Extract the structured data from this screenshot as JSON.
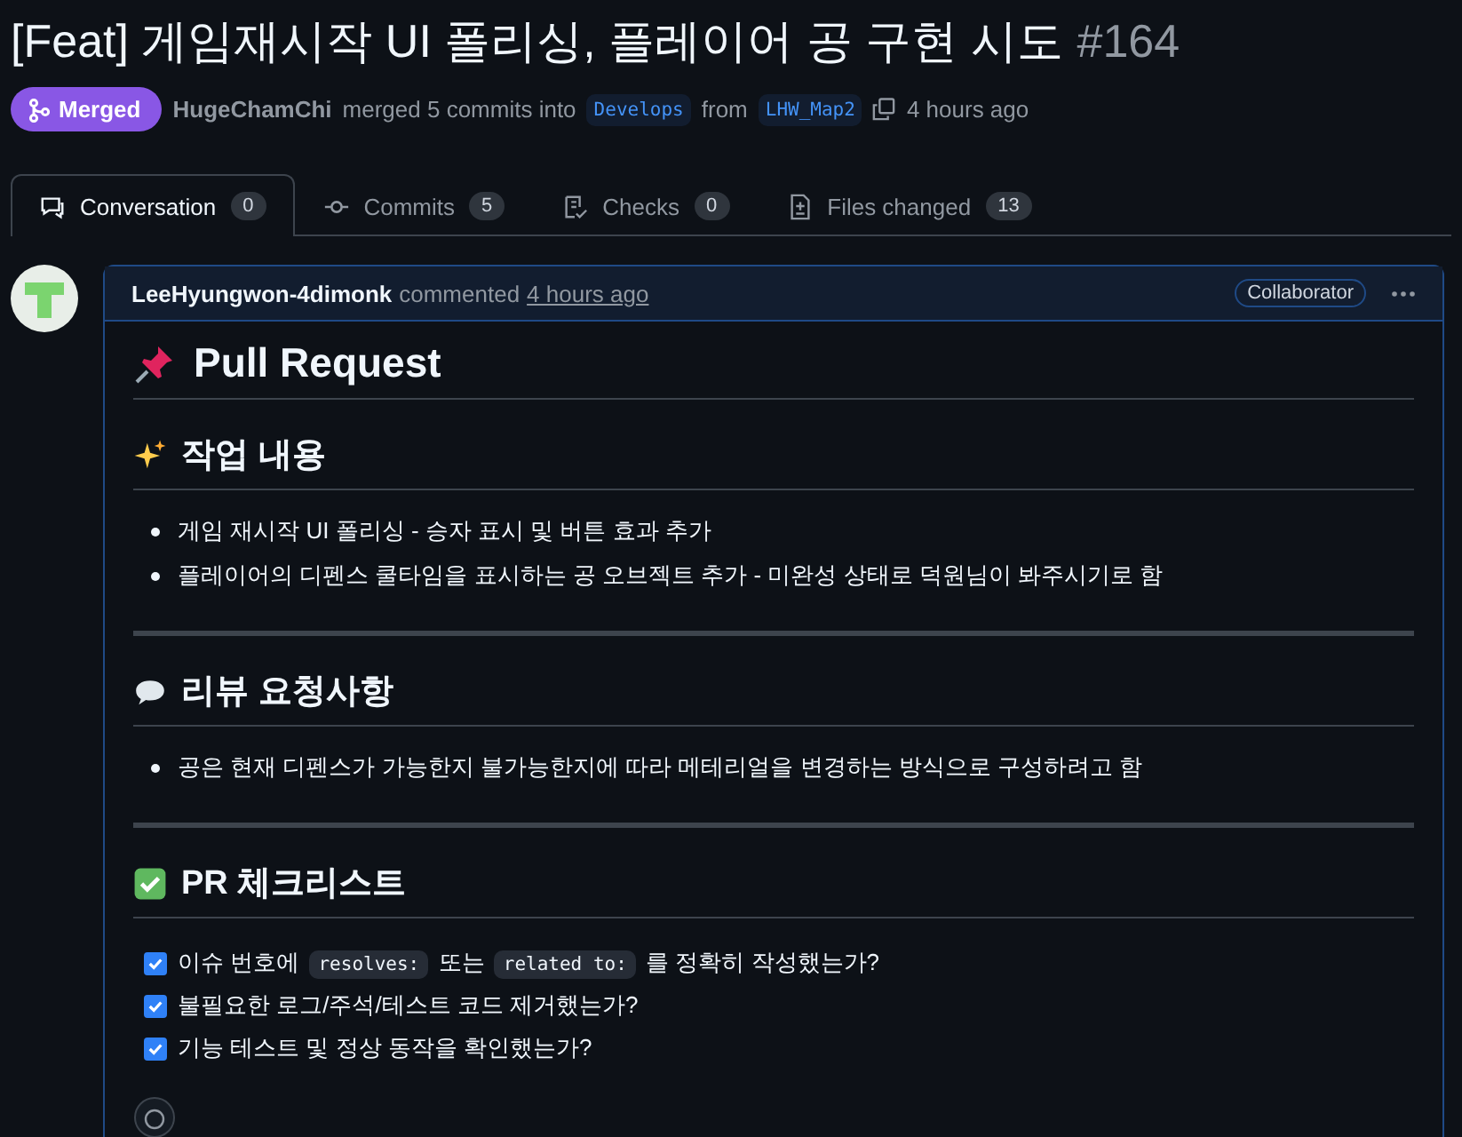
{
  "title": {
    "text": "[Feat] 게임재시작 UI 폴리싱, 플레이어 공 구현 시도",
    "number": "#164"
  },
  "status": {
    "label": "Merged"
  },
  "meta": {
    "author": "HugeChamChi",
    "action": "merged 5 commits into",
    "base": "Develops",
    "from": "from",
    "head": "LHW_Map2",
    "time": "4 hours ago"
  },
  "tabs": [
    {
      "label": "Conversation",
      "count": "0",
      "selected": true
    },
    {
      "label": "Commits",
      "count": "5",
      "selected": false
    },
    {
      "label": "Checks",
      "count": "0",
      "selected": false
    },
    {
      "label": "Files changed",
      "count": "13",
      "selected": false
    }
  ],
  "comment": {
    "author": "LeeHyungwon-4dimonk",
    "action": "commented",
    "time": "4 hours ago",
    "role": "Collaborator",
    "heading": {
      "text": "Pull Request"
    },
    "sections": [
      {
        "heading": "작업 내용",
        "kind": "bullets",
        "items": [
          {
            "parts": [
              {
                "kind": "text",
                "text": "게임 재시작 UI 폴리싱 - 승자 표시 및 버튼 효과 추가"
              }
            ]
          },
          {
            "parts": [
              {
                "kind": "text",
                "text": "플레이어의 디펜스 쿨타임을 표시하는 공 오브젝트 추가 - 미완성 상태로 덕원님이 봐주시기로 함"
              }
            ]
          }
        ]
      },
      {
        "heading": "리뷰 요청사항",
        "kind": "bullets",
        "items": [
          {
            "parts": [
              {
                "kind": "text",
                "text": "공은 현재 디펜스가 가능한지 불가능한지에 따라 메테리얼을 변경하는 방식으로 구성하려고 함"
              }
            ]
          }
        ]
      },
      {
        "heading": "PR 체크리스트",
        "kind": "tasks",
        "items": [
          {
            "checked": true,
            "parts": [
              {
                "kind": "text",
                "text": "이슈 번호에 "
              },
              {
                "kind": "code",
                "text": "resolves:"
              },
              {
                "kind": "text",
                "text": " 또는 "
              },
              {
                "kind": "code",
                "text": "related to:"
              },
              {
                "kind": "text",
                "text": " 를 정확히 작성했는가?"
              }
            ]
          },
          {
            "checked": true,
            "parts": [
              {
                "kind": "text",
                "text": "불필요한 로그/주석/테스트 코드 제거했는가?"
              }
            ]
          },
          {
            "checked": true,
            "parts": [
              {
                "kind": "text",
                "text": "기능 테스트 및 정상 동작을 확인했는가?"
              }
            ]
          }
        ]
      }
    ]
  }
}
